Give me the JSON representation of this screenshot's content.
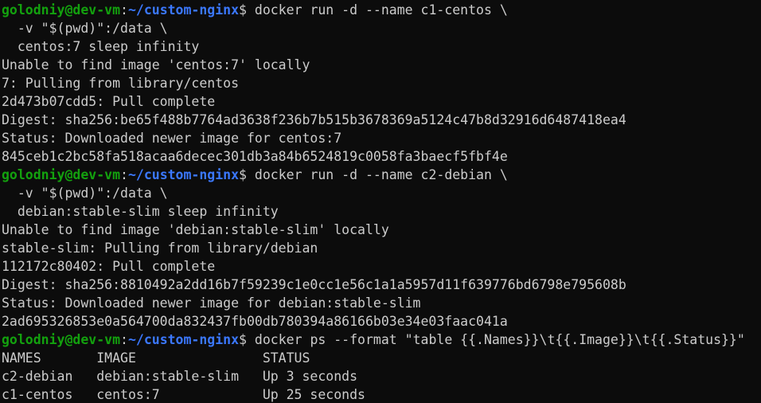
{
  "prompt": {
    "user_host": "golodniy@dev-vm",
    "sep": ":",
    "path": "~/custom-nginx",
    "dollar": "$"
  },
  "lines": [
    {
      "kind": "prompt",
      "cmd": " docker run -d --name c1-centos \\"
    },
    {
      "kind": "out",
      "text": "  -v \"$(pwd)\":/data \\"
    },
    {
      "kind": "out",
      "text": "  centos:7 sleep infinity"
    },
    {
      "kind": "out",
      "text": "Unable to find image 'centos:7' locally"
    },
    {
      "kind": "out",
      "text": "7: Pulling from library/centos"
    },
    {
      "kind": "out",
      "text": "2d473b07cdd5: Pull complete"
    },
    {
      "kind": "out",
      "text": "Digest: sha256:be65f488b7764ad3638f236b7b515b3678369a5124c47b8d32916d6487418ea4"
    },
    {
      "kind": "out",
      "text": "Status: Downloaded newer image for centos:7"
    },
    {
      "kind": "out",
      "text": "845ceb1c2bc58fa518acaa6decec301db3a84b6524819c0058fa3baecf5fbf4e"
    },
    {
      "kind": "prompt",
      "cmd": " docker run -d --name c2-debian \\"
    },
    {
      "kind": "out",
      "text": "  -v \"$(pwd)\":/data \\"
    },
    {
      "kind": "out",
      "text": "  debian:stable-slim sleep infinity"
    },
    {
      "kind": "out",
      "text": "Unable to find image 'debian:stable-slim' locally"
    },
    {
      "kind": "out",
      "text": "stable-slim: Pulling from library/debian"
    },
    {
      "kind": "out",
      "text": "112172c80402: Pull complete"
    },
    {
      "kind": "out",
      "text": "Digest: sha256:8810492a2dd16b7f59239c1e0cc1e56c1a1a5957d11f639776bd6798e795608b"
    },
    {
      "kind": "out",
      "text": "Status: Downloaded newer image for debian:stable-slim"
    },
    {
      "kind": "out",
      "text": "2ad695326853e0a564700da832437fb00db780394a86166b03e34e03faac041a"
    },
    {
      "kind": "prompt",
      "cmd": " docker ps --format \"table {{.Names}}\\t{{.Image}}\\t{{.Status}}\""
    },
    {
      "kind": "out",
      "text": "NAMES       IMAGE                STATUS"
    },
    {
      "kind": "out",
      "text": "c2-debian   debian:stable-slim   Up 3 seconds"
    },
    {
      "kind": "out",
      "text": "c1-centos   centos:7             Up 25 seconds"
    }
  ],
  "colors": {
    "background": "#0c0c0c",
    "text": "#cccccc",
    "user_host": "#13a10e",
    "path": "#3b78ff"
  }
}
